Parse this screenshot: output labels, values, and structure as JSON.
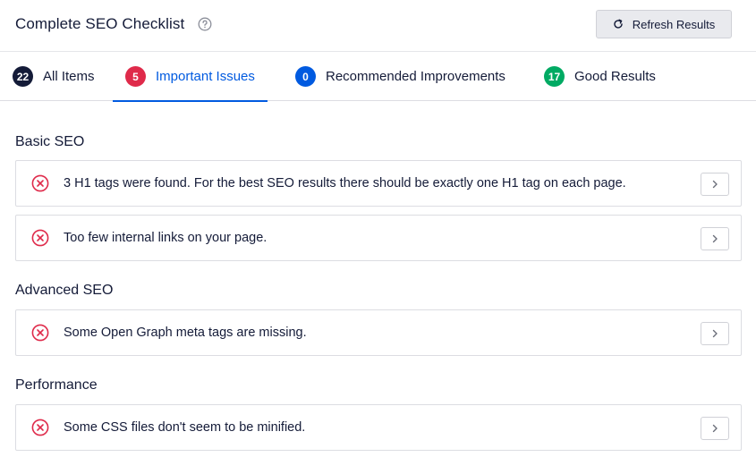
{
  "header": {
    "title": "Complete SEO Checklist",
    "help_icon": "question-circle-icon",
    "refresh_label": "Refresh Results",
    "refresh_icon": "refresh-icon"
  },
  "tabs": [
    {
      "label": "All Items",
      "count": "22",
      "color": "#141b38",
      "active": false
    },
    {
      "label": "Important Issues",
      "count": "5",
      "color": "#df2a4a",
      "active": true
    },
    {
      "label": "Recommended Improvements",
      "count": "0",
      "color": "#005ae0",
      "active": false
    },
    {
      "label": "Good Results",
      "count": "17",
      "color": "#00aa63",
      "active": false
    }
  ],
  "colors": {
    "accent": "#005ae0",
    "error": "#df2a4a",
    "text": "#141b38"
  },
  "sections": [
    {
      "title": "Basic SEO",
      "items": [
        {
          "text": "3 H1 tags were found. For the best SEO results there should be exactly one H1 tag on each page.",
          "icon": "error-x-icon"
        },
        {
          "text": "Too few internal links on your page.",
          "icon": "error-x-icon"
        }
      ]
    },
    {
      "title": "Advanced SEO",
      "items": [
        {
          "text": "Some Open Graph meta tags are missing.",
          "icon": "error-x-icon"
        }
      ]
    },
    {
      "title": "Performance",
      "items": [
        {
          "text": "Some CSS files don't seem to be minified.",
          "icon": "error-x-icon"
        }
      ]
    }
  ]
}
